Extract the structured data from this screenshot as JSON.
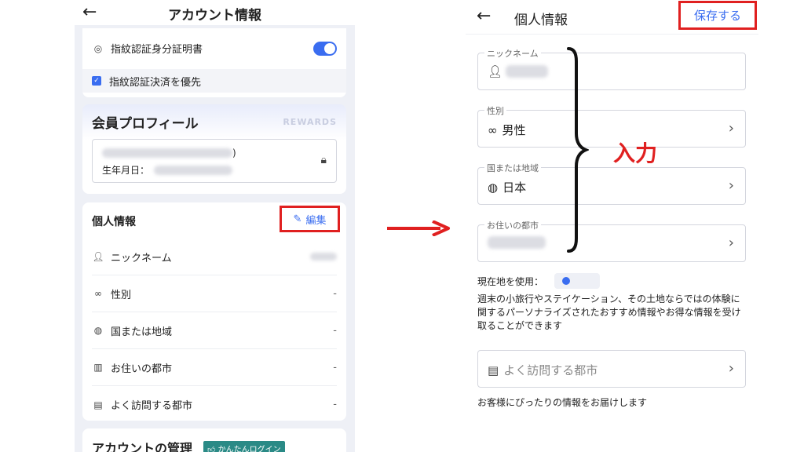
{
  "left": {
    "header_title": "アカウント情報",
    "fingerprint_id": "指紋認証身分証明書",
    "fingerprint_pay": "指紋認証決済を優先",
    "member_title": "会員プロフィール",
    "rewards": "REWARDS",
    "member_paren": ")",
    "birthday_label": "生年月日：",
    "personal_title": "個人情報",
    "edit_label": "編集",
    "items": [
      {
        "label": "ニックネーム",
        "value": ""
      },
      {
        "label": "性別",
        "value": "-"
      },
      {
        "label": "国または地域",
        "value": "-"
      },
      {
        "label": "お住いの都市",
        "value": "-"
      },
      {
        "label": "よく訪問する都市",
        "value": "-"
      }
    ],
    "account_title": "アカウントの管理",
    "easy_login": "かんたんログイン"
  },
  "right": {
    "header_title": "個人情報",
    "save_label": "保存する",
    "fields": [
      {
        "label": "ニックネーム",
        "value": ""
      },
      {
        "label": "性別",
        "value": "男性"
      },
      {
        "label": "国または地域",
        "value": "日本"
      },
      {
        "label": "お住いの都市",
        "value": ""
      }
    ],
    "annotation": "入力",
    "location_label": "現在地を使用：",
    "description": "週末の小旅行やステイケーション、その土地ならではの体験に関するパーソナライズされたおすすめ情報やお得な情報を受け取ることができます",
    "freq_placeholder": "よく訪問する都市",
    "freq_note": "お客様にぴったりの情報をお届けします"
  },
  "colors": {
    "accent": "#3a6df0",
    "highlight": "#e02020",
    "badge": "#2a8a86"
  }
}
